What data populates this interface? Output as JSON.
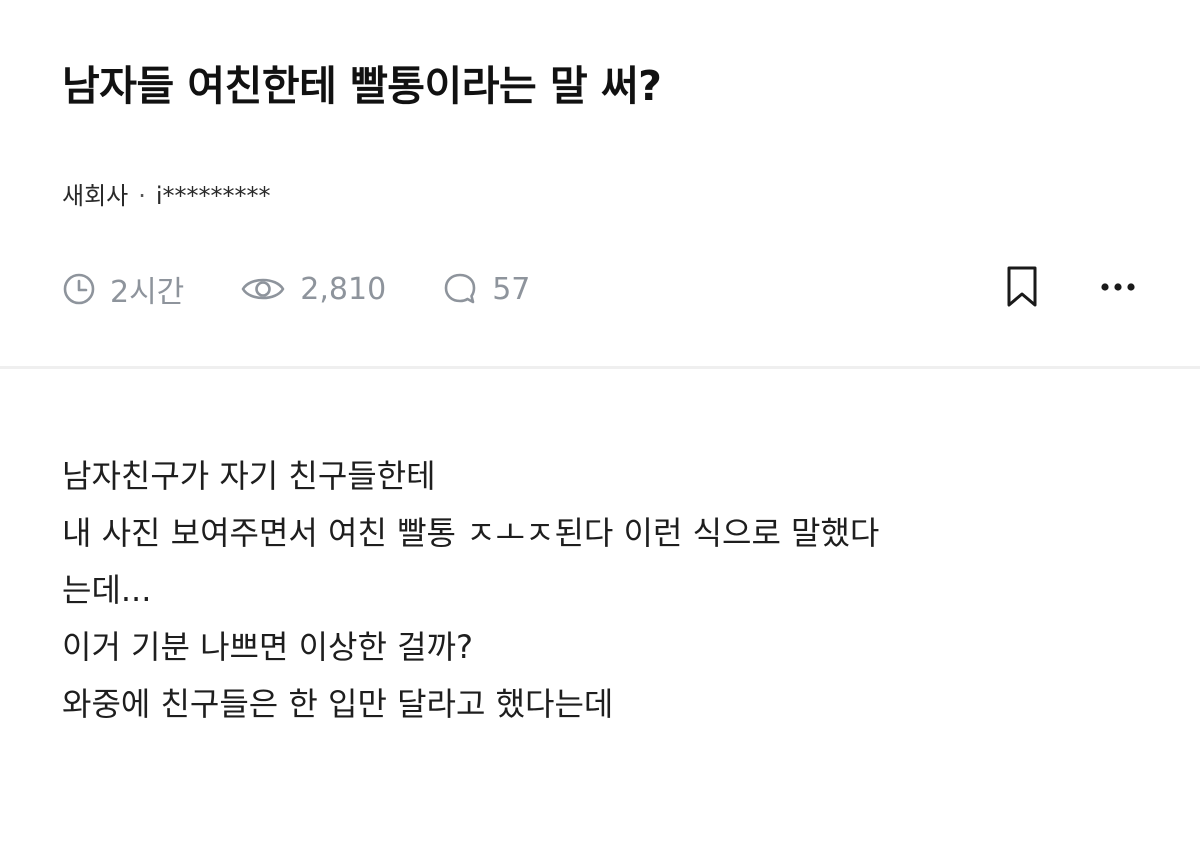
{
  "post": {
    "title": "남자들 여친한테 빨통이라는 말 써?",
    "company": "새회사",
    "separator": "·",
    "author": "i*********",
    "meta": {
      "time": "2시간",
      "views": "2,810",
      "comments": "57"
    },
    "body_lines": [
      "남자친구가 자기 친구들한테",
      "내 사진 보여주면서 여친 빨통 ㅈㅗㅈ된다 이런 식으로 말했다",
      "는데...",
      "이거 기분 나쁘면 이상한 걸까?",
      "와중에 친구들은 한 입만 달라고 했다는데"
    ]
  },
  "icons": {
    "time": "clock-icon",
    "views": "eye-icon",
    "comments": "speech-bubble-icon",
    "bookmark": "bookmark-icon",
    "more": "more-horizontal-icon"
  },
  "colors": {
    "title": "#111111",
    "meta": "#8e949c",
    "divider": "#efefef",
    "icon_dark": "#1a1a1a"
  }
}
